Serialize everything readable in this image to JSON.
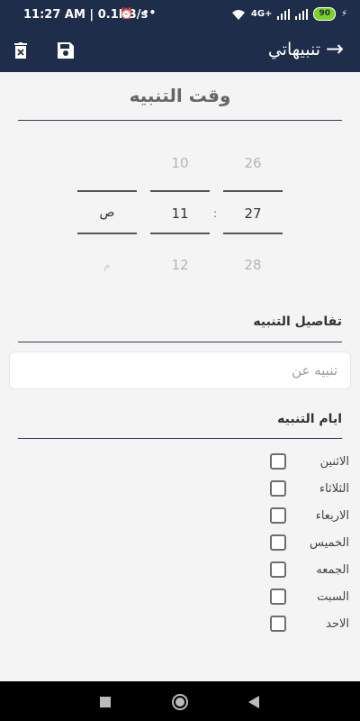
{
  "status_bar": {
    "time": "11:27 AM | 0.1KB/s",
    "network": "4G+",
    "battery": "90"
  },
  "app_bar": {
    "title": "تنبيهاتي"
  },
  "time_section": {
    "title": "وقت التنبيه"
  },
  "picker": {
    "day": {
      "prev": "26",
      "current": "27",
      "next": "28"
    },
    "hour": {
      "prev": "10",
      "current": "11",
      "next": "12"
    },
    "ampm": {
      "current": "ص",
      "next": "م"
    },
    "separator": ":"
  },
  "details": {
    "title": "تفاصيل التنبيه",
    "placeholder": "تنبيه عن"
  },
  "days": {
    "title": "ايام التنبيه",
    "items": [
      {
        "label": "الاثنين"
      },
      {
        "label": "الثلاثاء"
      },
      {
        "label": "الاربعاء"
      },
      {
        "label": "الخميس"
      },
      {
        "label": "الجمعه"
      },
      {
        "label": "السبت"
      },
      {
        "label": "الاحد"
      }
    ]
  },
  "colors": {
    "primary": "#1e2d4a",
    "background": "#f4f4f4"
  }
}
